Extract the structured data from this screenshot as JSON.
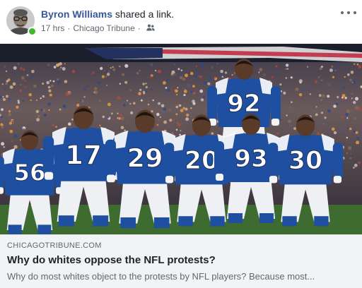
{
  "post": {
    "author": "Byron Williams",
    "action": "shared a link.",
    "time": "17 hrs",
    "source": "Chicago Tribune",
    "separator": "·",
    "audience_icon": "friends-icon",
    "more_icon": "more-horizontal-icon"
  },
  "link": {
    "domain": "CHICAGOTRIBUNE.COM",
    "title": "Why do whites oppose the NFL protests?",
    "description": "Why do most whites object to the protests by NFL players? Because most...",
    "info_icon_label": "i"
  },
  "photo": {
    "players": [
      {
        "number": "56"
      },
      {
        "number": "17"
      },
      {
        "number": "29"
      },
      {
        "number": "20"
      },
      {
        "number": "93"
      },
      {
        "number": "30"
      },
      {
        "number": "92"
      }
    ],
    "colors": {
      "jersey_blue": "#1f4fa0",
      "helmet_blue": "#1a3c80",
      "pants_white": "#eef0f3",
      "grass": "#3e6b2f",
      "crowd": "#3a3440"
    }
  },
  "colors": {
    "author_link": "#365899",
    "online": "#42b72a",
    "preview_bg": "#f2f3f5"
  }
}
